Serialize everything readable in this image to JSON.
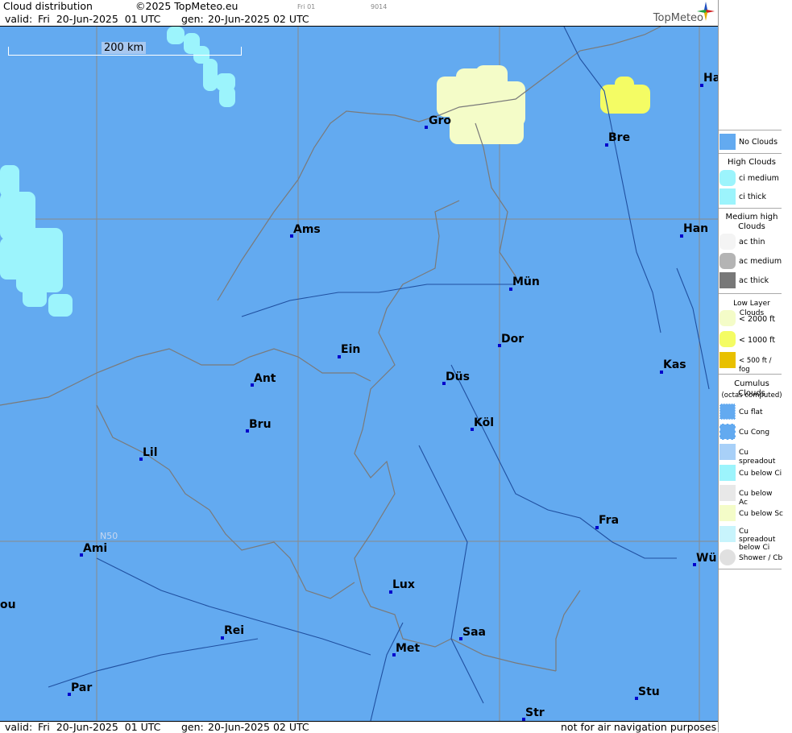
{
  "header": {
    "title": "Cloud distribution",
    "copyright": "©2025 TopMeteo.eu",
    "day_code": "Fri 01",
    "code": "9014",
    "valid_label": "valid:",
    "valid_value": "Fri  20-Jun-2025  01 UTC",
    "gen_label": "gen:",
    "gen_value": "20-Jun-2025 02 UTC",
    "logo_text": "TopMeteo"
  },
  "footer": {
    "valid_label": "valid:",
    "valid_value": "Fri  20-Jun-2025  01 UTC",
    "gen_label": "gen:",
    "gen_value": "20-Jun-2025 02 UTC",
    "disclaimer": "not for air navigation purposes"
  },
  "map": {
    "scale_label": "200 km",
    "lat_label": "N50",
    "colors": {
      "no_clouds": "#63aaf0",
      "ci": "#9cf4fc",
      "low_2000": "#f4fcc8",
      "low_1000": "#f4fc64",
      "border": "#8a8a8a",
      "river": "#2050a0",
      "city": "#0000cc"
    },
    "cities": [
      {
        "name": "Gro"
      },
      {
        "name": "Bre"
      },
      {
        "name": "Ha"
      },
      {
        "name": "Ams"
      },
      {
        "name": "Han"
      },
      {
        "name": "Mün"
      },
      {
        "name": "Dor"
      },
      {
        "name": "Ein"
      },
      {
        "name": "Ant"
      },
      {
        "name": "Düs"
      },
      {
        "name": "Kas"
      },
      {
        "name": "Bru"
      },
      {
        "name": "Köl"
      },
      {
        "name": "Lil"
      },
      {
        "name": "Fra"
      },
      {
        "name": "Ami"
      },
      {
        "name": "Wü"
      },
      {
        "name": "Lux"
      },
      {
        "name": "ou"
      },
      {
        "name": "Rei"
      },
      {
        "name": "Saa"
      },
      {
        "name": "Met"
      },
      {
        "name": "Par"
      },
      {
        "name": "Stu"
      },
      {
        "name": "Str"
      }
    ]
  },
  "legend": {
    "no_clouds": "No Clouds",
    "high_head": "High Clouds",
    "ci_medium": "ci medium",
    "ci_thick": "ci thick",
    "medium_head": "Medium high Clouds",
    "ac_thin": "ac thin",
    "ac_medium": "ac medium",
    "ac_thick": "ac thick",
    "low_head": "Low Layer Clouds",
    "low_2000": "< 2000 ft",
    "low_1000": "< 1000 ft",
    "low_500": "< 500 ft / fog",
    "cu_head": "Cumulus Clouds",
    "cu_sub": "(octas computed)",
    "cu_flat": "Cu flat",
    "cu_cong": "Cu Cong",
    "cu_spread": "Cu spreadout",
    "cu_below_ci": "Cu below Ci",
    "cu_below_ac": "Cu below Ac",
    "cu_below_sc": "Cu below Sc",
    "cu_spread_ci": "Cu spreadout below Ci",
    "shower": "Shower / Cb"
  }
}
